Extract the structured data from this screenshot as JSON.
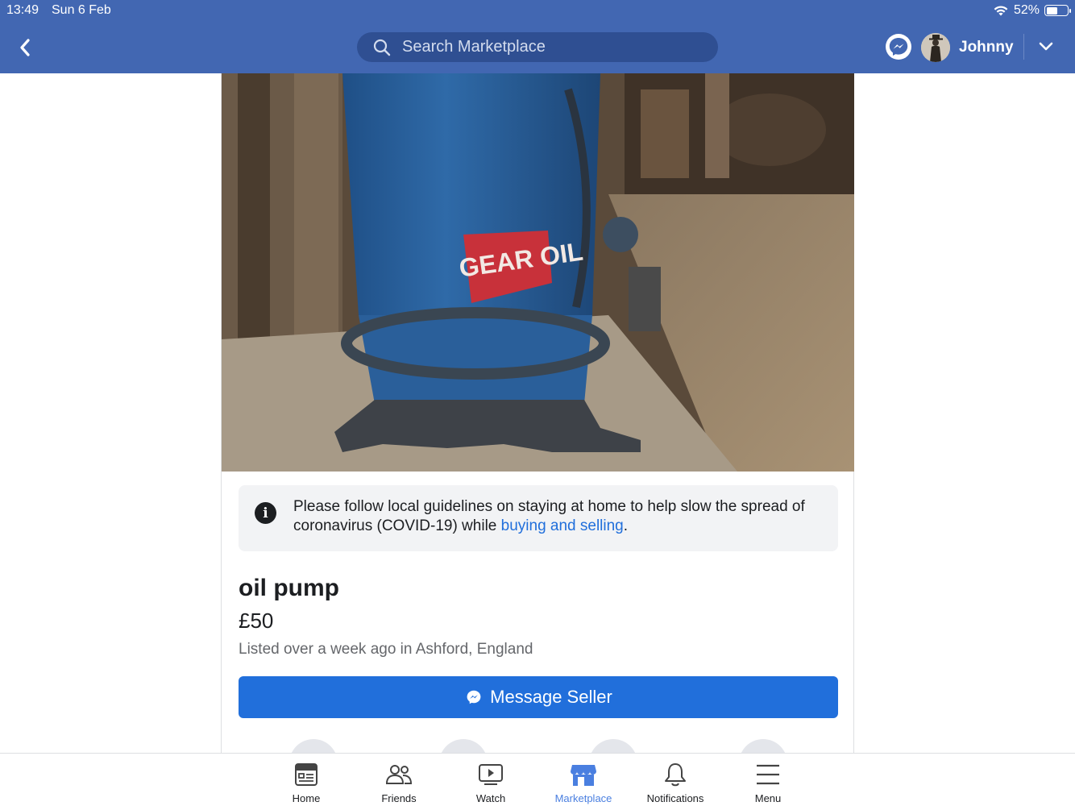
{
  "status_bar": {
    "time": "13:49",
    "date": "Sun 6 Feb",
    "battery": "52%",
    "battery_level": 0.52
  },
  "header": {
    "search_placeholder": "Search Marketplace",
    "username": "Johnny"
  },
  "listing": {
    "image_text": "GEAR OIL",
    "notice_text": "Please follow local guidelines on staying at home to help slow the spread of coronavirus (COVID-19) while ",
    "notice_link": "buying and selling",
    "notice_end": ".",
    "title": "oil pump",
    "price": "£50",
    "listed": "Listed over a week ago in Ashford, England",
    "message_button": "Message Seller"
  },
  "tabbar": {
    "tabs": [
      {
        "label": "Home",
        "icon": "home-feed-icon"
      },
      {
        "label": "Friends",
        "icon": "friends-icon"
      },
      {
        "label": "Watch",
        "icon": "watch-icon"
      },
      {
        "label": "Marketplace",
        "icon": "marketplace-icon",
        "active": true
      },
      {
        "label": "Notifications",
        "icon": "bell-icon"
      },
      {
        "label": "Menu",
        "icon": "hamburger-icon"
      }
    ]
  },
  "colors": {
    "brand": "#4267b2",
    "accent": "#216fdb",
    "active_tab": "#4a7fe0"
  }
}
